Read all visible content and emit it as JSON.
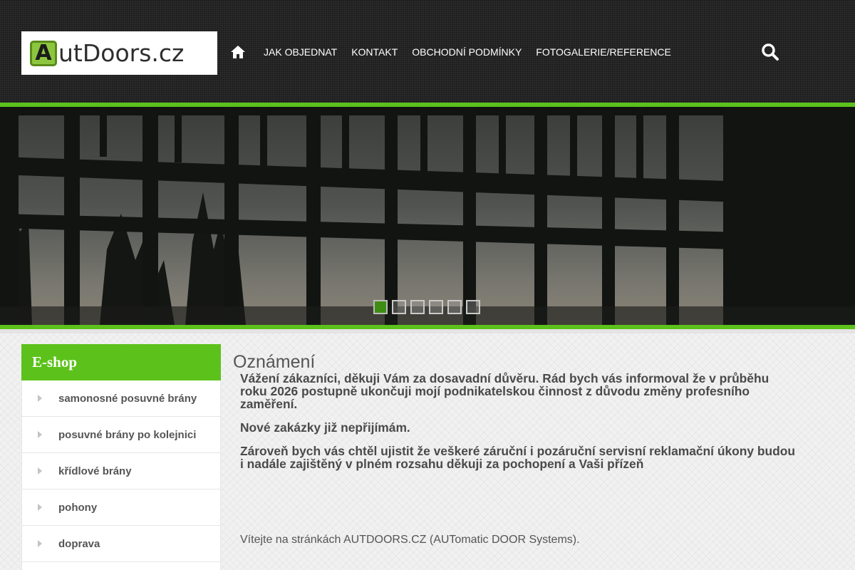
{
  "logo": {
    "letter": "A",
    "text": "utDoors.cz"
  },
  "nav": {
    "home_icon": "home-icon",
    "items": [
      "JAK OBJEDNAT",
      "KONTAKT",
      "OBCHODNÍ PODMÍNKY",
      "FOTOGALERIE/REFERENCE"
    ],
    "search_icon": "search-icon"
  },
  "slider": {
    "slides": 6,
    "active": 1
  },
  "sidebar": {
    "title": "E-shop",
    "items": [
      "samonosné posuvné brány",
      "posuvné brány po kolejnici",
      "křídlové brány",
      "pohony",
      "doprava"
    ]
  },
  "content": {
    "title": "Oznámení",
    "paragraphs": [
      "Vážení zákazníci, děkuji Vám za dosavadní důvěru. Rád bych vás informoval že v průběhu roku 2026 postupně ukončuji mojí podnikatelskou činnost z důvodu změny profesního zaměření.",
      "Nové zakázky již nepřijímám.",
      "Zároveň bych vás chtěl ujistit že veškeré záruční i pozáruční servisní reklamační úkony budou i nadále zajištěný v plném rozsahu děkuji za pochopení a Vaši přízeň"
    ],
    "welcome": "Vítejte na stránkách AUTDOORS.CZ (AUTomatic DOOR Systems)."
  },
  "colors": {
    "accent": "#5cc21b",
    "header_bg": "#1e1e1e",
    "dot_active": "#3e8d12"
  }
}
